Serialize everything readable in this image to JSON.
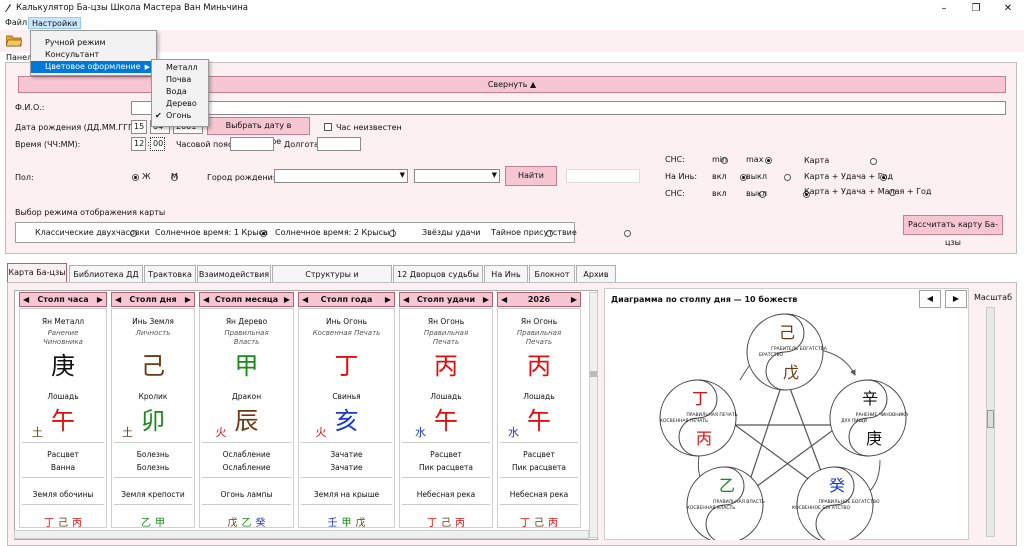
{
  "window": {
    "title": "Калькулятор Ба-цзы Школа Мастера Ван Миньчина"
  },
  "menubar": {
    "file": "Файл",
    "settings": "Настройки"
  },
  "settings_menu": {
    "items": [
      "Ручной режим",
      "Консультант",
      "Цветовое оформление"
    ]
  },
  "theme_submenu": {
    "items": [
      "Металл",
      "Почва",
      "Вода",
      "Дерево",
      "Огонь"
    ],
    "checked": "Огонь"
  },
  "panel": {
    "label": "Панел",
    "collapse_button": "Свернуть ▲"
  },
  "form": {
    "fio_label": "Ф.И.О.:",
    "fio_value": "",
    "birth_date_label": "Дата рождения (ДД.ММ.ГГГГ):",
    "birth_day": "15",
    "birth_month": "04",
    "birth_year": "2001",
    "pick_date_button": "Выбрать дату в календаре",
    "hour_unknown_label": "Час неизвестен",
    "time_label": "Время (ЧЧ:ММ):",
    "hour": "12",
    "minute": "00",
    "timezone_label": "Часовой пояс:",
    "longitude_label": "Долгота:",
    "gender_label": "Пол:",
    "gender_m": "Ж",
    "gender_f": "М",
    "city_label": "Город рождения:",
    "find_button": "Найти"
  },
  "options": {
    "shs_label": "СНС:",
    "min": "min",
    "max": "max",
    "nain_label": "На Инь:",
    "on": "вкл",
    "off": "выкл",
    "shs2_label": "СНС:",
    "map_opts": [
      "Карта",
      "Карта + Удача + Год",
      "Карта + Удача + Малая + Год"
    ]
  },
  "display_mode": {
    "label": "Выбор режима отображения карты",
    "options": [
      "Классические двухчасовки",
      "Солнечное время: 1 Крыса",
      "Солнечное время: 2 Крысы",
      "|",
      "Звёзды удачи",
      "Тайное присутствие"
    ],
    "selected": 1
  },
  "calc_button": "Рассчитать карту Ба-цзы",
  "tabs": [
    "Карта Ба-цзы",
    "Библиотека ДД",
    "Трактовка",
    "Взаимодействия",
    "Структуры и Конфигурации",
    "12 Дворцов судьбы",
    "На Инь",
    "Блокнот",
    "Архив"
  ],
  "pillars": [
    {
      "header": "Столп часа",
      "stem_name": "Ян Металл",
      "stem_god": "Ранение Чиновника",
      "stem_char": "庚",
      "stem_color": "#111111",
      "branch_name": "Лошадь",
      "branch_el": "土",
      "branch_el_color": "#6b3a12",
      "branch_char": "午",
      "branch_color": "#e01010",
      "state1": "Расцвет",
      "state2": "Ванна",
      "nayin": "Земля обочины",
      "hidden": [
        {
          "c": "丁",
          "col": "#e01010"
        },
        {
          "c": "己",
          "col": "#6b3a12"
        },
        {
          "c": "丙",
          "col": "#e01010"
        }
      ]
    },
    {
      "header": "Столп дня",
      "stem_name": "Инь Земля",
      "stem_god": "Личность",
      "stem_char": "己",
      "stem_color": "#6b3a12",
      "branch_name": "Кролик",
      "branch_el": "土",
      "branch_el_color": "#6b3a12",
      "branch_char": "卯",
      "branch_color": "#1a8a1a",
      "state1": "Болезнь",
      "state2": "Болезнь",
      "nayin": "Земля крепости",
      "hidden": [
        {
          "c": "乙",
          "col": "#1a8a1a"
        },
        {
          "c": "甲",
          "col": "#1a8a1a"
        }
      ]
    },
    {
      "header": "Столп месяца",
      "stem_name": "Ян Дерево",
      "stem_god": "Правильная Власть",
      "stem_char": "甲",
      "stem_color": "#1a8a1a",
      "branch_name": "Дракон",
      "branch_el": "火",
      "branch_el_color": "#e01010",
      "branch_char": "辰",
      "branch_color": "#6b3a12",
      "state1": "Ослабление",
      "state2": "Ослабление",
      "nayin": "Огонь лампы",
      "hidden": [
        {
          "c": "戊",
          "col": "#6b3a12"
        },
        {
          "c": "乙",
          "col": "#1a8a1a"
        },
        {
          "c": "癸",
          "col": "#1a3acc"
        }
      ]
    },
    {
      "header": "Столп года",
      "stem_name": "Инь Огонь",
      "stem_god": "Косвенная Печать",
      "stem_char": "丁",
      "stem_color": "#e01010",
      "branch_name": "Свинья",
      "branch_el": "火",
      "branch_el_color": "#e01010",
      "branch_char": "亥",
      "branch_color": "#1a3acc",
      "state1": "Зачатие",
      "state2": "Зачатие",
      "nayin": "Земля на крыше",
      "hidden": [
        {
          "c": "壬",
          "col": "#1a3acc"
        },
        {
          "c": "甲",
          "col": "#1a8a1a"
        },
        {
          "c": "戊",
          "col": "#6b3a12"
        }
      ]
    },
    {
      "header": "Столп удачи",
      "stem_name": "Ян Огонь",
      "stem_god": "Правильная Печать",
      "stem_char": "丙",
      "stem_color": "#e01010",
      "branch_name": "Лошадь",
      "branch_el": "水",
      "branch_el_color": "#1a3acc",
      "branch_char": "午",
      "branch_color": "#e01010",
      "state1": "Расцвет",
      "state2": "Пик расцвета",
      "nayin": "Небесная река",
      "hidden": [
        {
          "c": "丁",
          "col": "#e01010"
        },
        {
          "c": "己",
          "col": "#6b3a12"
        },
        {
          "c": "丙",
          "col": "#e01010"
        }
      ]
    },
    {
      "header": "2026",
      "stem_name": "Ян Огонь",
      "stem_god": "Правильная Печать",
      "stem_char": "丙",
      "stem_color": "#e01010",
      "branch_name": "Лошадь",
      "branch_el": "水",
      "branch_el_color": "#1a3acc",
      "branch_char": "午",
      "branch_color": "#e01010",
      "state1": "Расцвет",
      "state2": "Пик расцвета",
      "nayin": "Небесная река",
      "hidden": [
        {
          "c": "丁",
          "col": "#e01010"
        },
        {
          "c": "己",
          "col": "#6b3a12"
        },
        {
          "c": "丙",
          "col": "#e01010"
        }
      ]
    }
  ],
  "diagram": {
    "title": "Диаграмма по столпу дня — 10 божеств",
    "scale_label": "Масштаб",
    "nodes": [
      {
        "top_char": "己",
        "top_color": "#6b3a12",
        "bot_char": "戊",
        "bot_color": "#6b3a12",
        "l1": "БРАТСТВО",
        "l2": "ГРАБИТЕЛЬ БОГАТСТВА"
      },
      {
        "top_char": "辛",
        "top_color": "#111111",
        "bot_char": "庚",
        "bot_color": "#111111",
        "l1": "ДУХ ПИЩИ",
        "l2": "РАНЕНИЕ ЧИНОВНИКА"
      },
      {
        "top_char": "丁",
        "top_color": "#e01010",
        "bot_char": "丙",
        "bot_color": "#e01010",
        "l1": "КОСВЕННАЯ ПЕЧАТЬ",
        "l2": "ПРАВИЛЬНАЯ ПЕЧАТЬ"
      },
      {
        "top_char": "癸",
        "top_color": "#1a3acc",
        "bot_char": "",
        "bot_color": "#1a3acc",
        "l1": "КОСВЕННОЕ БОГАТСТВО",
        "l2": "ПРАВИЛЬНОЕ БОГАТСТВО"
      },
      {
        "top_char": "乙",
        "top_color": "#1a8a1a",
        "bot_char": "",
        "bot_color": "#1a8a1a",
        "l1": "КОСВЕННАЯ ВЛАСТЬ",
        "l2": "ПРАВИЛЬНАЯ ВЛАСТЬ"
      }
    ]
  },
  "colors": {
    "pink": "#f6c6d3",
    "panel_bg": "#fdf0f3"
  }
}
